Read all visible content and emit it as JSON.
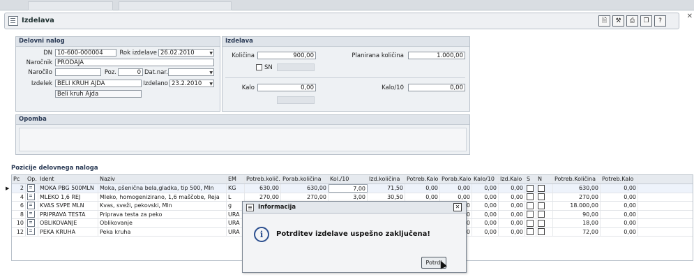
{
  "window": {
    "title": "Izdelava"
  },
  "toolbar": {
    "icons": [
      "document-icon",
      "tools-icon",
      "print-icon",
      "copy-icon",
      "help-icon"
    ],
    "help_label": "?"
  },
  "delovni_nalog": {
    "header": "Delovni nalog",
    "dn_label": "DN",
    "dn_value": "10-600-000004",
    "rok_label": "Rok izdelave",
    "rok_value": "26.02.2010",
    "narocnik_label": "Naročnik",
    "narocnik_value": "PRODAJA",
    "narocilo_label": "Naročilo",
    "narocilo_value": "",
    "poz_label": "Poz.",
    "poz_value": "0",
    "datnar_label": "Dat.nar.",
    "datnar_value": "",
    "izdelek_label": "Izdelek",
    "izdelek_value": "BELI KRUH AJDA",
    "izdelano_label": "Izdelano",
    "izdelano_value": "23.2.2010",
    "izdelek_desc": "Beli kruh Ajda"
  },
  "izdelava": {
    "header": "Izdelava",
    "kolicina_label": "Količina",
    "kolicina_value": "900,00",
    "planirana_label": "Planirana količina",
    "planirana_value": "1.000,00",
    "sn_label": "SN",
    "kalo_label": "Kalo",
    "kalo_value": "0,00",
    "kalo10_label": "Kalo/10",
    "kalo10_value": "0,00"
  },
  "opomba": {
    "header": "Opomba"
  },
  "pozicije": {
    "title": "Pozicije delovnega naloga",
    "columns": [
      "Pc",
      "Op.",
      "Ident",
      "Naziv",
      "EM",
      "Potreb.količ.",
      "Porab.količina",
      "Kol./10",
      "Izd.količina",
      "Potreb.Kalo",
      "Porab.Kalo",
      "Kalo/10",
      "Izd.Kalo",
      "S",
      "N",
      "Potreb.Količina",
      "Potreb.Kalo"
    ],
    "rows": [
      {
        "pc": "2",
        "ident": "MOKA PBG 500MLN",
        "naziv": "Moka, pšenična bela,gladka, tip 500, Mln",
        "em": "KG",
        "potreb": "630,00",
        "porab": "630,00",
        "kol10": "7,00",
        "izd": "71,50",
        "pkalo": "0,00",
        "porkalo": "0,00",
        "kalo10": "0,00",
        "izdkalo": "0,00",
        "potreb2": "630,00",
        "pkalo2": "0,00"
      },
      {
        "pc": "4",
        "ident": "MLEKO 1,6 REJ",
        "naziv": "Mleko, homogenizirano, 1,6 maščobe, Reja",
        "em": "L",
        "potreb": "270,00",
        "porab": "270,00",
        "kol10": "3,00",
        "izd": "30,50",
        "pkalo": "0,00",
        "porkalo": "0,00",
        "kalo10": "0,00",
        "izdkalo": "0,00",
        "potreb2": "270,00",
        "pkalo2": "0,00"
      },
      {
        "pc": "6",
        "ident": "KVAS SVPE MLN",
        "naziv": "Kvas, sveži, pekovski, Mln",
        "em": "g",
        "potreb": "",
        "porab": "",
        "kol10": "",
        "izd": "",
        "pkalo": "",
        "porkalo": "0,00",
        "kalo10": "0,00",
        "izdkalo": "0,00",
        "potreb2": "18.000,00",
        "pkalo2": "0,00"
      },
      {
        "pc": "8",
        "ident": "PRIPRAVA TESTA",
        "naziv": "Priprava testa za peko",
        "em": "URA",
        "potreb": "",
        "porab": "",
        "kol10": "",
        "izd": "",
        "pkalo": "",
        "porkalo": "0,00",
        "kalo10": "0,00",
        "izdkalo": "0,00",
        "potreb2": "90,00",
        "pkalo2": "0,00"
      },
      {
        "pc": "10",
        "ident": "OBLIKOVANJE",
        "naziv": "Oblikovanje",
        "em": "URA",
        "potreb": "",
        "porab": "",
        "kol10": "",
        "izd": "",
        "pkalo": "",
        "porkalo": "0,00",
        "kalo10": "0,00",
        "izdkalo": "0,00",
        "potreb2": "18,00",
        "pkalo2": "0,00"
      },
      {
        "pc": "12",
        "ident": "PEKA KRUHA",
        "naziv": "Peka kruha",
        "em": "URA",
        "potreb": "",
        "porab": "",
        "kol10": "",
        "izd": "",
        "pkalo": "",
        "porkalo": "0,00",
        "kalo10": "0,00",
        "izdkalo": "0,00",
        "potreb2": "72,00",
        "pkalo2": "0,00"
      }
    ]
  },
  "dialog": {
    "title": "Informacija",
    "message": "Potrditev izdelave uspešno zaključena!",
    "ok_label": "Potrdi"
  }
}
